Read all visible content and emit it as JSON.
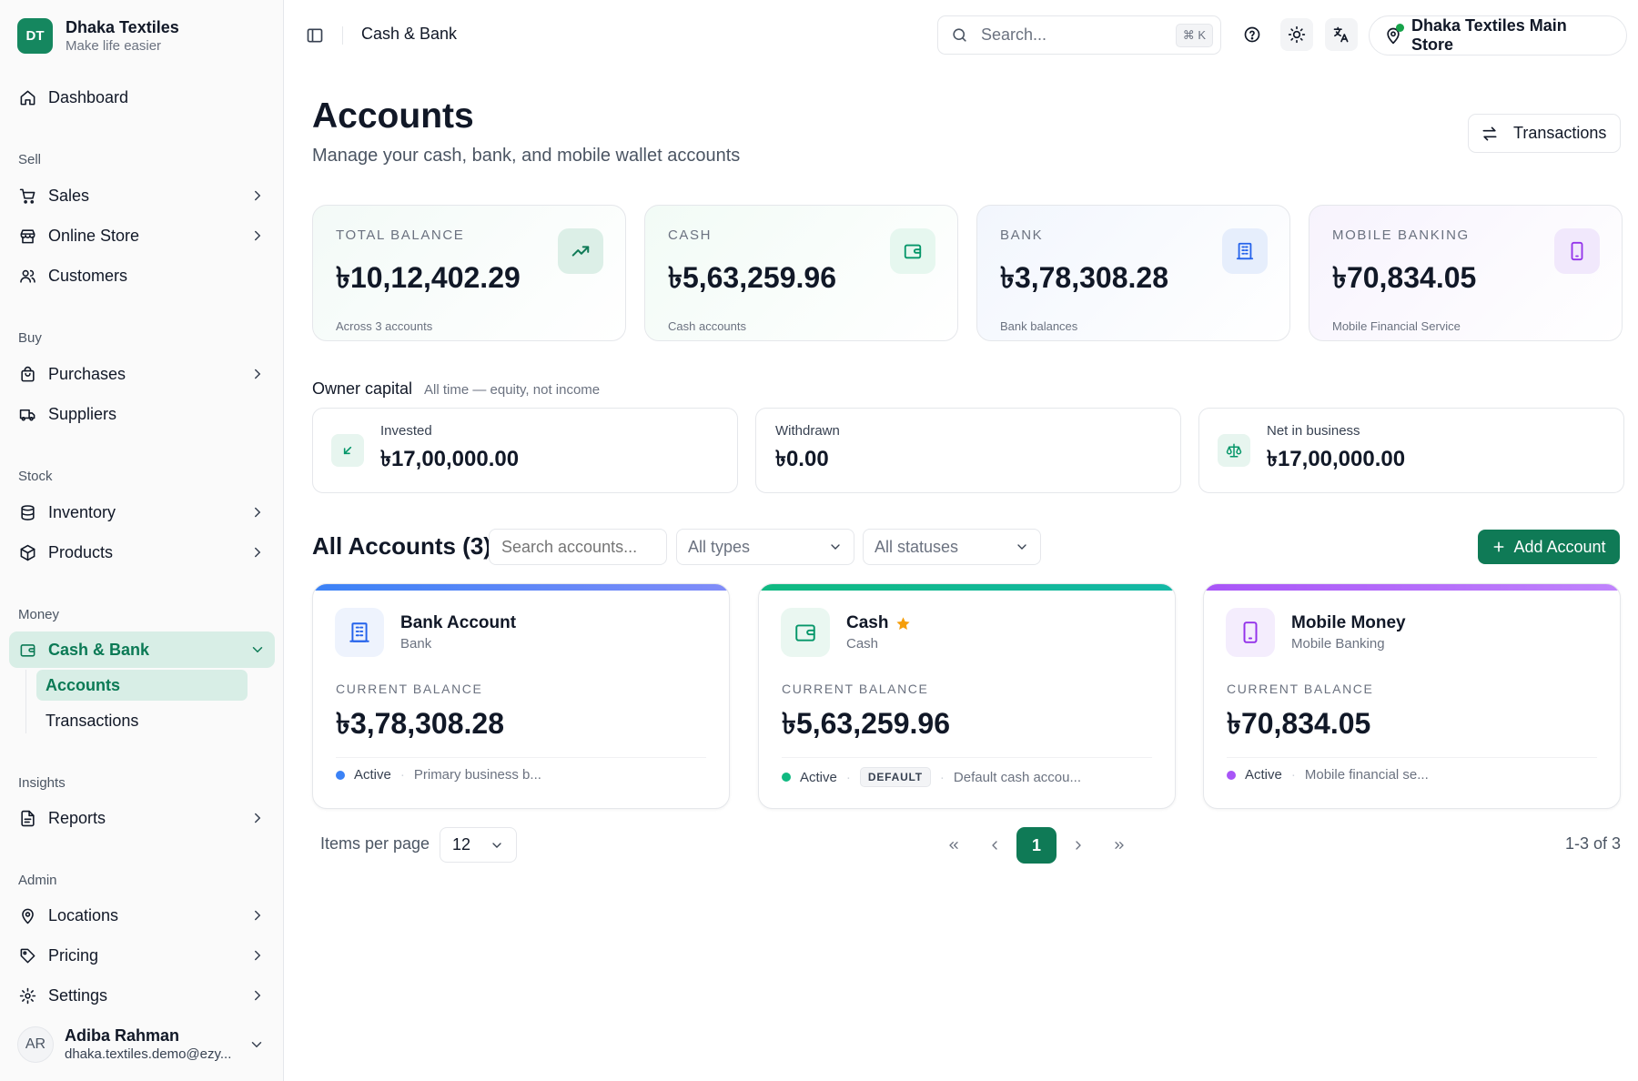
{
  "brand": {
    "initials": "DT",
    "name": "Dhaka Textiles",
    "tagline": "Make life easier"
  },
  "nav": {
    "dashboard": "Dashboard",
    "sections": {
      "sell": "Sell",
      "buy": "Buy",
      "stock": "Stock",
      "money": "Money",
      "insights": "Insights",
      "admin": "Admin"
    },
    "sales": "Sales",
    "online_store": "Online Store",
    "customers": "Customers",
    "purchases": "Purchases",
    "suppliers": "Suppliers",
    "inventory": "Inventory",
    "products": "Products",
    "cash_bank": "Cash & Bank",
    "accounts": "Accounts",
    "transactions": "Transactions",
    "reports": "Reports",
    "locations": "Locations",
    "pricing": "Pricing",
    "settings": "Settings"
  },
  "user": {
    "initials": "AR",
    "name": "Adiba Rahman",
    "email": "dhaka.textiles.demo@ezy..."
  },
  "header": {
    "breadcrumb": "Cash & Bank",
    "search_placeholder": "Search...",
    "search_shortcut": "⌘ K",
    "store": "Dhaka Textiles Main Store"
  },
  "page": {
    "title": "Accounts",
    "subtitle": "Manage your cash, bank, and mobile wallet accounts",
    "transactions_button": "Transactions"
  },
  "stats": [
    {
      "label": "TOTAL BALANCE",
      "value": "৳10,12,402.29",
      "note": "Across 3 accounts"
    },
    {
      "label": "CASH",
      "value": "৳5,63,259.96",
      "note": "Cash accounts"
    },
    {
      "label": "BANK",
      "value": "৳3,78,308.28",
      "note": "Bank balances"
    },
    {
      "label": "MOBILE BANKING",
      "value": "৳70,834.05",
      "note": "Mobile Financial Service"
    }
  ],
  "owner": {
    "title": "Owner capital",
    "note": "All time — equity, not income",
    "invested_label": "Invested",
    "invested_value": "৳17,00,000.00",
    "withdrawn_label": "Withdrawn",
    "withdrawn_value": "৳0.00",
    "net_label": "Net in business",
    "net_value": "৳17,00,000.00"
  },
  "accounts_list": {
    "title": "All Accounts (3)",
    "search_placeholder": "Search accounts...",
    "type_filter": "All types",
    "status_filter": "All statuses",
    "add_button": "Add Account",
    "balance_label": "CURRENT BALANCE",
    "cards": [
      {
        "name": "Bank Account",
        "type": "Bank",
        "balance": "৳3,78,308.28",
        "status": "Active",
        "description": "Primary business b...",
        "accent": "#3b82f6"
      },
      {
        "name": "Cash",
        "type": "Cash",
        "balance": "৳5,63,259.96",
        "status": "Active",
        "badge": "DEFAULT",
        "description": "Default cash accou...",
        "accent": "#10b981"
      },
      {
        "name": "Mobile Money",
        "type": "Mobile Banking",
        "balance": "৳70,834.05",
        "status": "Active",
        "description": "Mobile financial se...",
        "accent": "#a855f7"
      }
    ]
  },
  "pagination": {
    "items_label": "Items per page",
    "items_value": "12",
    "current_page": "1",
    "range": "1-3 of 3"
  },
  "colors": {
    "primary": "#0f7a56",
    "active_bg": "#d8eee6",
    "bank": "#2563eb",
    "cash": "#059669",
    "mobile": "#9333ea"
  }
}
